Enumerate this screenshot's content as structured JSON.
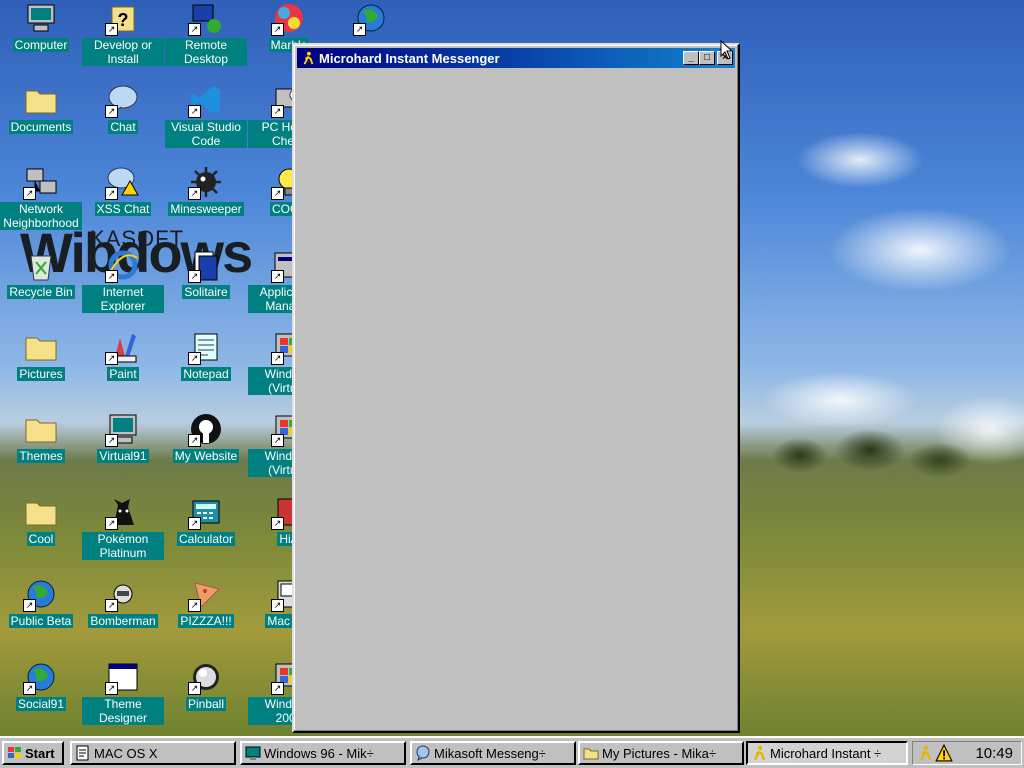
{
  "desktop": {
    "wallpaper_logo": "Wibdows",
    "wallpaper_logo_sub": "KASOFT",
    "icons": [
      {
        "label": "Computer",
        "icon": "computer-icon"
      },
      {
        "label": "Develop or Install",
        "icon": "help-icon"
      },
      {
        "label": "Remote Desktop",
        "icon": "remote-desktop-icon"
      },
      {
        "label": "Marble",
        "icon": "marble-icon"
      },
      {
        "label": "",
        "icon": "globe-icon"
      },
      {
        "label": "Documents",
        "icon": "folder-icon"
      },
      {
        "label": "Chat",
        "icon": "chat-icon"
      },
      {
        "label": "Visual Studio Code",
        "icon": "vscode-icon"
      },
      {
        "label": "PC Health Check",
        "icon": "health-check-icon"
      },
      {
        "label": "Network Neighborhood",
        "icon": "network-icon"
      },
      {
        "label": "XSS Chat",
        "icon": "warning-chat-icon"
      },
      {
        "label": "Minesweeper",
        "icon": "mine-icon"
      },
      {
        "label": "COOL",
        "icon": "bulb-icon"
      },
      {
        "label": "Recycle Bin",
        "icon": "recycle-bin-icon"
      },
      {
        "label": "Internet Explorer",
        "icon": "ie-icon"
      },
      {
        "label": "Solitaire",
        "icon": "solitaire-icon"
      },
      {
        "label": "Application Manager",
        "icon": "app-manager-icon"
      },
      {
        "label": "Pictures",
        "icon": "folder-icon"
      },
      {
        "label": "Paint",
        "icon": "paint-icon"
      },
      {
        "label": "Notepad",
        "icon": "notepad-icon"
      },
      {
        "label": "Windows (Virtual)",
        "icon": "windows-virtual-icon"
      },
      {
        "label": "Themes",
        "icon": "folder-icon"
      },
      {
        "label": "Virtual91",
        "icon": "monitor-icon"
      },
      {
        "label": "My Website",
        "icon": "github-icon"
      },
      {
        "label": "Windows (Virtual)",
        "icon": "windows-virtual-icon"
      },
      {
        "label": "Cool",
        "icon": "folder-icon"
      },
      {
        "label": "Pokémon Platinum",
        "icon": "pokemon-icon"
      },
      {
        "label": "Calculator",
        "icon": "calculator-icon"
      },
      {
        "label": "HiA",
        "icon": "hia-icon"
      },
      {
        "label": "Public Beta",
        "icon": "globe-icon"
      },
      {
        "label": "Bomberman",
        "icon": "bomberman-icon"
      },
      {
        "label": "PIZZZA!!!",
        "icon": "pizza-icon"
      },
      {
        "label": "Mac OS",
        "icon": "mac-icon"
      },
      {
        "label": "Social91",
        "icon": "globe-icon"
      },
      {
        "label": "Theme Designer",
        "icon": "theme-designer-icon"
      },
      {
        "label": "Pinball",
        "icon": "pinball-icon"
      },
      {
        "label": "Windows 2000",
        "icon": "windows-virtual-icon"
      }
    ]
  },
  "window": {
    "title": "Microhard Instant Messenger",
    "minimize": "_",
    "maximize": "□",
    "close": "×"
  },
  "taskbar": {
    "start_label": "Start",
    "tasks": [
      {
        "label": "MAC OS X",
        "icon": "notepad-icon"
      },
      {
        "label": "Windows 96 - Mik÷",
        "icon": "monitor-icon"
      },
      {
        "label": "Mikasoft Messeng÷",
        "icon": "chat-icon"
      },
      {
        "label": "My Pictures - Mika÷",
        "icon": "folder-icon"
      },
      {
        "label": "Microhard Instant ÷",
        "icon": "messenger-icon"
      }
    ],
    "clock": "10:49"
  },
  "colors": {
    "title_start": "#000080",
    "title_end": "#1084d0",
    "label_bg": "#008080",
    "chrome": "#c0c0c0"
  }
}
